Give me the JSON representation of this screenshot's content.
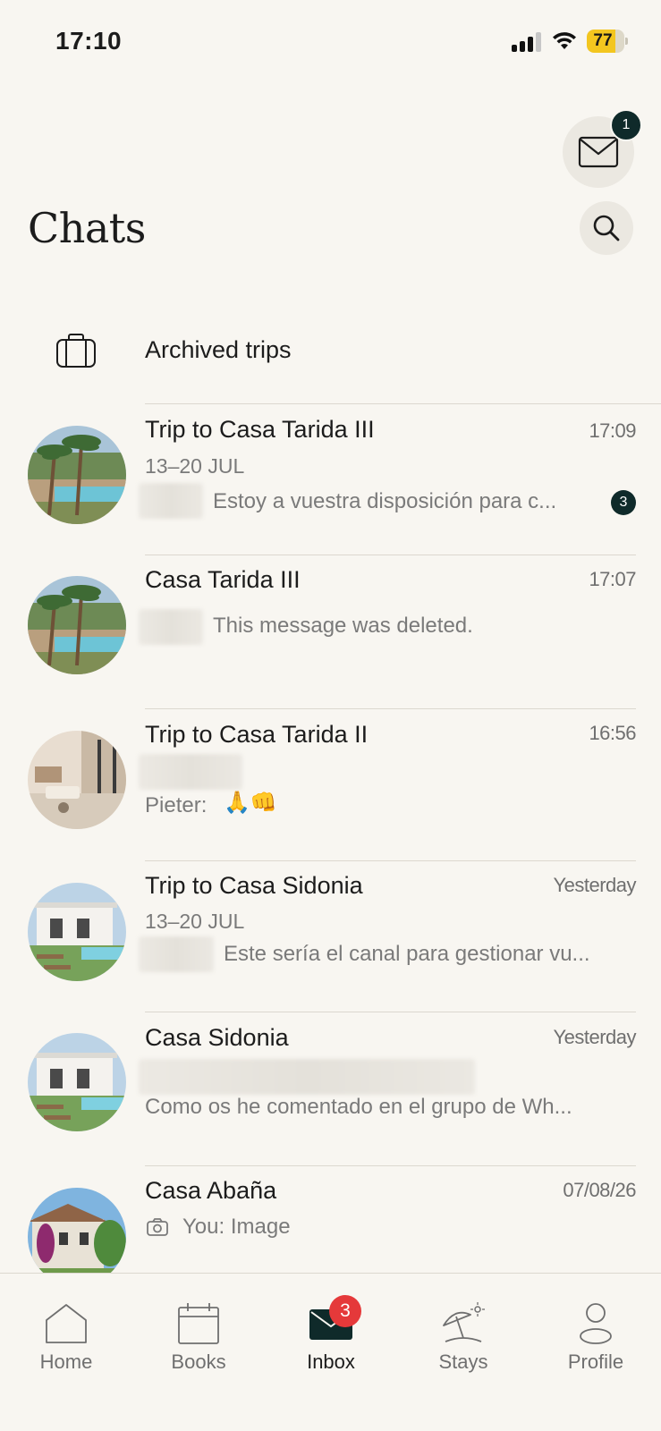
{
  "status_bar": {
    "time": "17:10",
    "battery": "77"
  },
  "header": {
    "title": "Chats",
    "mail_badge": "1"
  },
  "archived": {
    "label": "Archived trips"
  },
  "chats": [
    {
      "title": "Trip to Casa Tarida III",
      "time": "17:09",
      "dates": "13–20 JUL",
      "preview": "Estoy a vuestra disposición para c...",
      "unread": "3"
    },
    {
      "title": "Casa Tarida III",
      "time": "17:07",
      "preview": "This message was deleted."
    },
    {
      "title": "Trip to Casa Tarida II",
      "time": "16:56",
      "sender": "Pieter:",
      "preview_emoji": "🙏👊"
    },
    {
      "title": "Trip to Casa Sidonia",
      "time": "Yesterday",
      "dates": "13–20 JUL",
      "preview": "Este sería el canal para gestionar vu..."
    },
    {
      "title": "Casa Sidonia",
      "time": "Yesterday",
      "preview": "Como os he comentado en el grupo de Wh..."
    },
    {
      "title": "Casa Abaña",
      "time": "07/08/26",
      "preview": "You: Image",
      "preview_icon": "camera-icon"
    }
  ],
  "tabs": [
    {
      "label": "Home",
      "icon": "home-icon"
    },
    {
      "label": "Books",
      "icon": "calendar-icon"
    },
    {
      "label": "Inbox",
      "icon": "envelope-icon",
      "badge": "3",
      "active": true
    },
    {
      "label": "Stays",
      "icon": "beach-umbrella-icon"
    },
    {
      "label": "Profile",
      "icon": "person-icon"
    }
  ],
  "colors": {
    "background": "#f8f6f1",
    "badge_dark": "#0f2a2a",
    "badge_red": "#e5393a",
    "battery": "#f3c61f"
  }
}
